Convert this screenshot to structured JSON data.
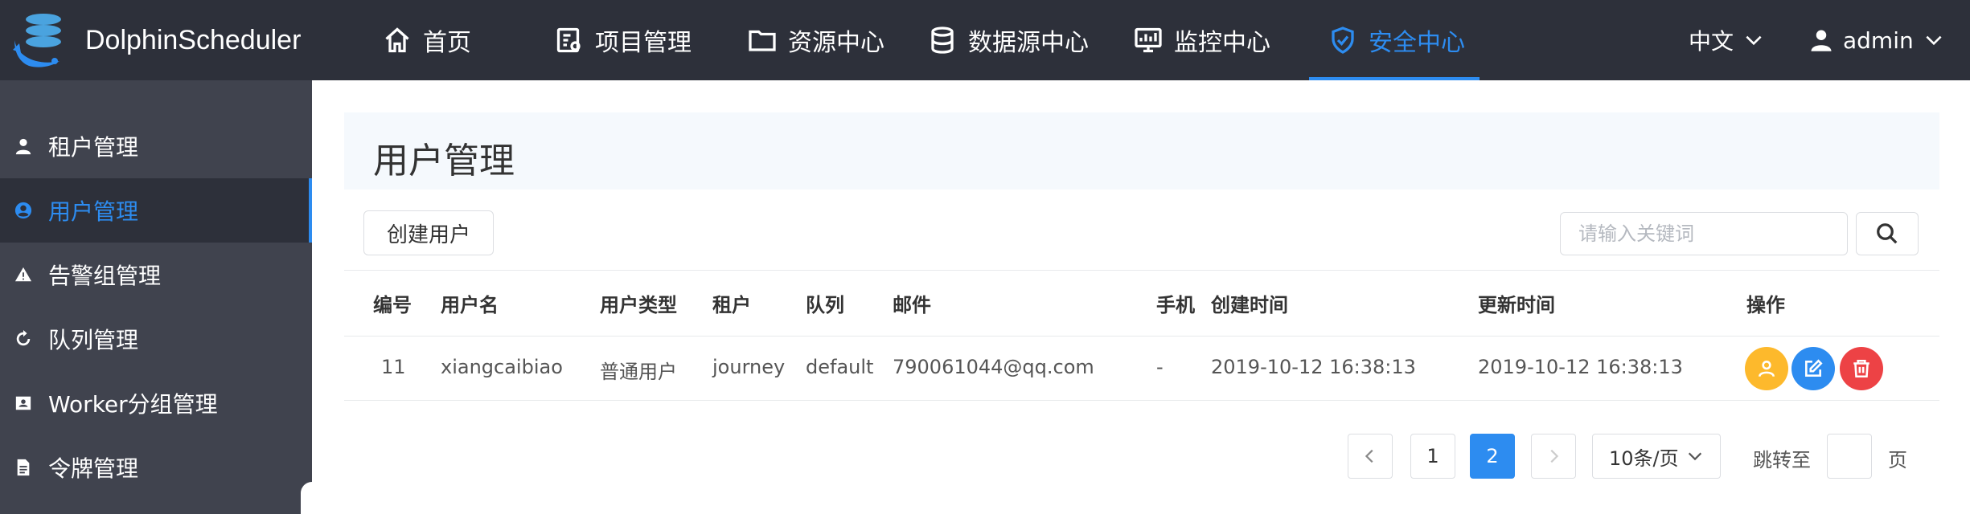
{
  "app": {
    "name": "DolphinScheduler"
  },
  "nav": {
    "items": [
      {
        "label": "首页",
        "icon": "home-icon"
      },
      {
        "label": "项目管理",
        "icon": "project-icon"
      },
      {
        "label": "资源中心",
        "icon": "folder-icon"
      },
      {
        "label": "数据源中心",
        "icon": "database-icon"
      },
      {
        "label": "监控中心",
        "icon": "monitor-icon"
      },
      {
        "label": "安全中心",
        "icon": "shield-icon",
        "active": true
      }
    ],
    "language": "中文",
    "user": "admin"
  },
  "sidebar": {
    "items": [
      {
        "label": "租户管理",
        "icon": "user-icon"
      },
      {
        "label": "用户管理",
        "icon": "user-circle-icon",
        "active": true
      },
      {
        "label": "告警组管理",
        "icon": "warning-icon"
      },
      {
        "label": "队列管理",
        "icon": "recycle-icon"
      },
      {
        "label": "Worker分组管理",
        "icon": "id-card-icon"
      },
      {
        "label": "令牌管理",
        "icon": "document-icon"
      }
    ]
  },
  "main": {
    "title": "用户管理",
    "create_button": "创建用户",
    "search_placeholder": "请输入关键词",
    "table": {
      "headers": [
        "编号",
        "用户名",
        "用户类型",
        "租户",
        "队列",
        "邮件",
        "手机",
        "创建时间",
        "更新时间",
        "操作"
      ],
      "rows": [
        {
          "id": "11",
          "username": "xiangcaibiao",
          "user_type": "普通用户",
          "tenant": "journey",
          "queue": "default",
          "email": "790061044@qq.com",
          "phone": "-",
          "create_time": "2019-10-12 16:38:13",
          "update_time": "2019-10-12 16:38:13"
        }
      ]
    },
    "pagination": {
      "pages": [
        "1",
        "2"
      ],
      "current_page": "2",
      "page_size": "10条/页",
      "jump_label": "跳转至",
      "page_suffix": "页"
    }
  },
  "colors": {
    "nav_bg": "#2d303a",
    "sidebar_bg": "#40434e",
    "accent": "#2d8cf0",
    "auth_button": "#fdb92c",
    "edit_button": "#2d8cf0",
    "delete_button": "#ed4245"
  }
}
